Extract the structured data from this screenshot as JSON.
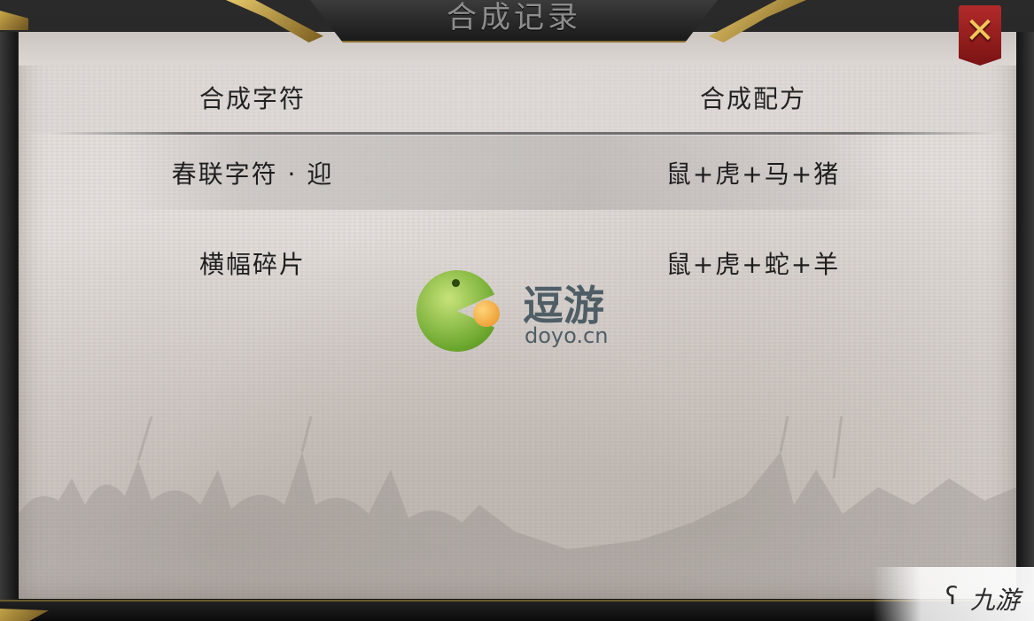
{
  "window": {
    "title": "合成记录",
    "close_symbol": "✕"
  },
  "table": {
    "headers": [
      "合成字符",
      "合成配方"
    ],
    "rows": [
      {
        "rune": "春联字符 · 迎",
        "recipe": "鼠+虎+马+猪"
      },
      {
        "rune": "横幅碎片",
        "recipe": "鼠+虎+蛇+羊"
      }
    ]
  },
  "watermark": {
    "cn": "逗游",
    "en": "doyo.cn"
  },
  "corner_badge": {
    "icon": "swirl-icon",
    "text": "九游"
  },
  "colors": {
    "parchment": "#e4dedb",
    "close_red": "#b22a2a",
    "gold": "#c9a84a",
    "watermark_green": "#6aa62c",
    "watermark_orange": "#e89020"
  }
}
